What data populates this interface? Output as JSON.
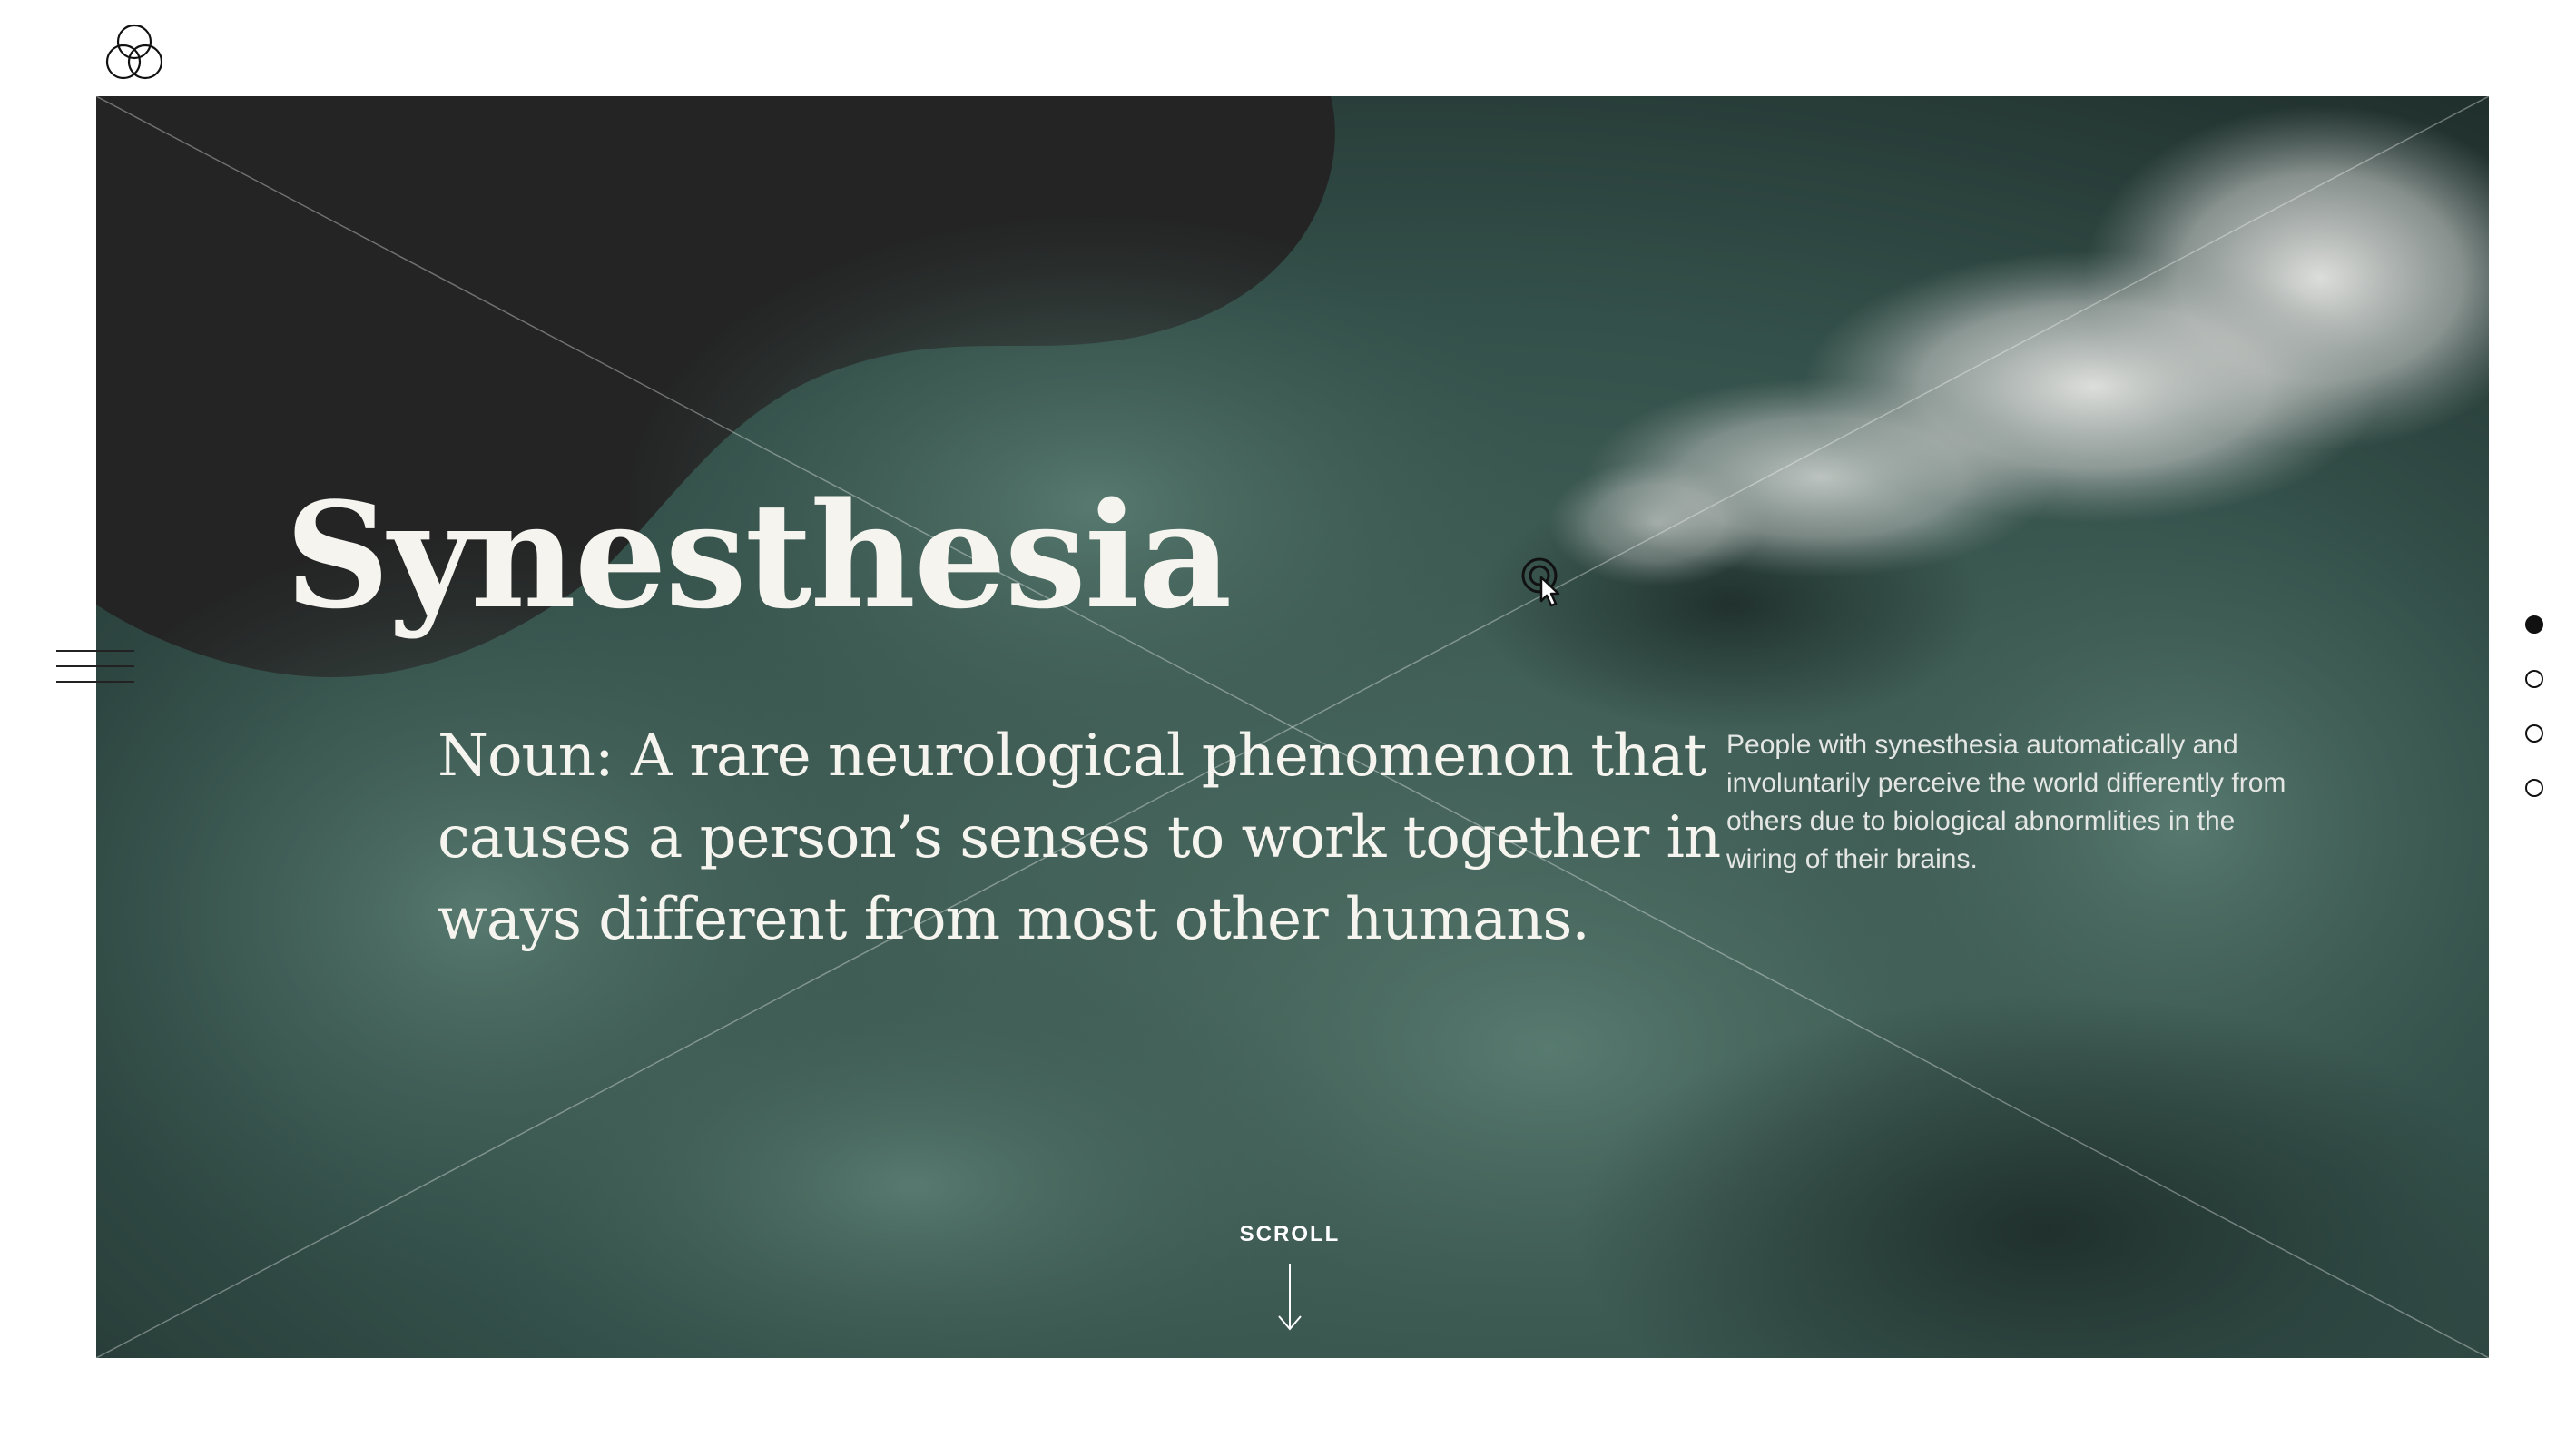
{
  "logo": {
    "icon": "three-circles-logo-icon"
  },
  "hero": {
    "title": "Synesthesia",
    "definition": "Noun: A rare neurological phenomenon that causes a person’s senses to work together in ways different from most other humans.",
    "aside": "People with synesthesia automatically and involuntarily perceive the world differently from others due to biological abnormlities in the wiring of their brains.",
    "scroll_label": "SCROLL"
  },
  "menu": {
    "icon": "hamburger-menu-icon"
  },
  "pagination": {
    "count": 4,
    "active_index": 0
  },
  "colors": {
    "background": "#ffffff",
    "hero_dark": "#242424",
    "hero_green": "#3e5a51",
    "text_light": "#f6f4ef",
    "dot": "#111111"
  }
}
